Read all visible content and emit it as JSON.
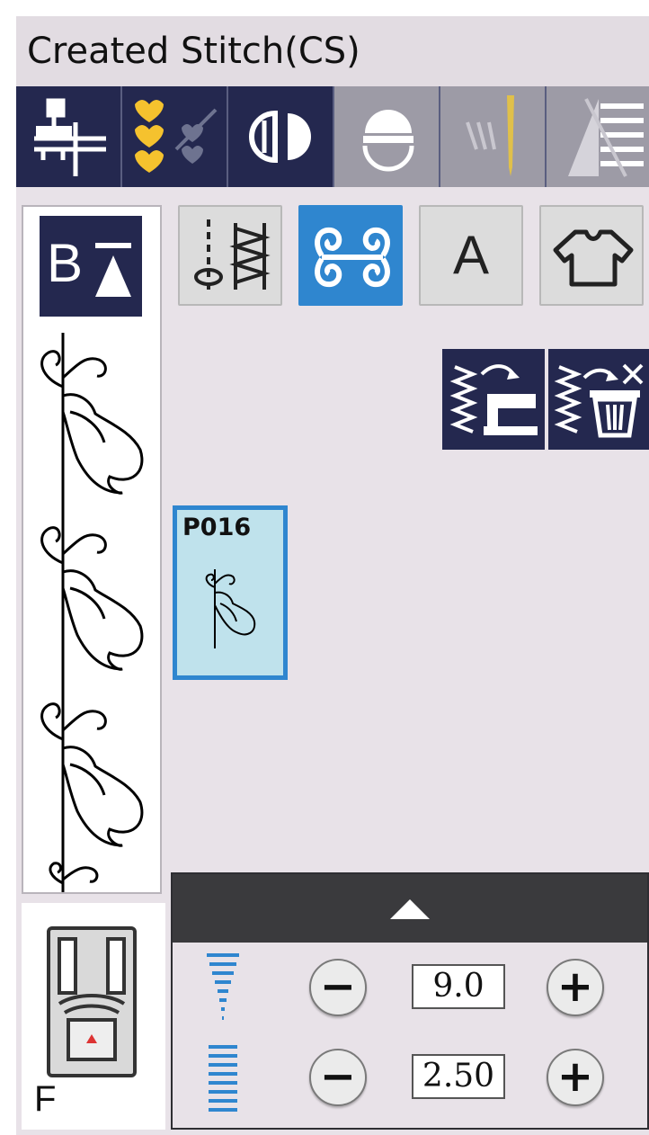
{
  "screen": {
    "title": "Created Stitch(CS)"
  },
  "mode_tabs": [
    {
      "icon": "presser-foot-icon",
      "state": "enabled"
    },
    {
      "icon": "hearts-stitch-icon",
      "state": "selected"
    },
    {
      "icon": "buttonhole-icon",
      "state": "enabled"
    },
    {
      "icon": "drum-icon",
      "state": "disabled"
    },
    {
      "icon": "needle-icon",
      "state": "disabled"
    },
    {
      "icon": "density-icon",
      "state": "disabled"
    }
  ],
  "sidebar": {
    "view_toggle_label": "B"
  },
  "categories": [
    {
      "icon": "utility-stitch-icon",
      "active": false
    },
    {
      "icon": "decorative-scroll-icon",
      "active": true
    },
    {
      "label": "A",
      "active": false
    },
    {
      "icon": "garment-icon",
      "active": false
    }
  ],
  "actions": [
    {
      "icon": "send-to-machine-icon"
    },
    {
      "icon": "delete-stitch-icon"
    }
  ],
  "patterns": [
    {
      "code": "P016",
      "selected": true
    }
  ],
  "adjustments": {
    "width": {
      "value": "9.0",
      "minus": "−",
      "plus": "+"
    },
    "length": {
      "value": "2.50",
      "minus": "−",
      "plus": "+"
    }
  },
  "presser_foot": {
    "label": "F"
  },
  "colors": {
    "navy": "#24284f",
    "accent_blue": "#2f86cf",
    "tile_blue": "#bfe2ec",
    "heart_yellow": "#f5c22e"
  }
}
